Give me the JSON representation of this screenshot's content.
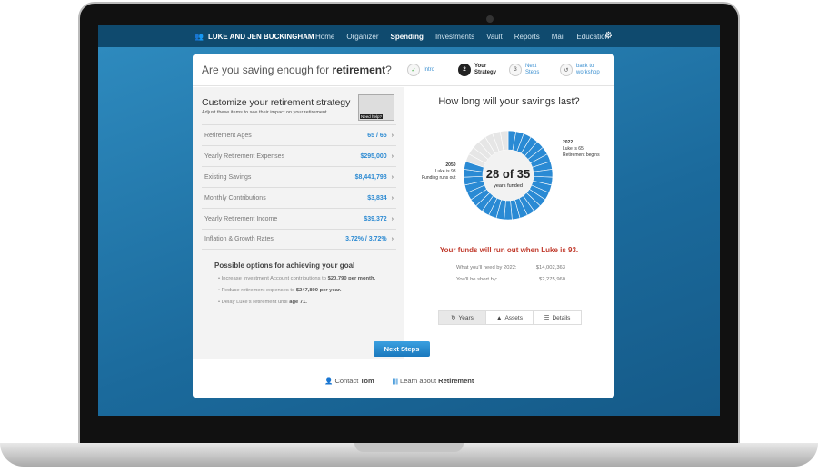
{
  "topbar": {
    "account": "LUKE AND JEN BUCKINGHAM",
    "nav": [
      "Home",
      "Organizer",
      "Spending",
      "Investments",
      "Vault",
      "Reports",
      "Mail",
      "Education"
    ],
    "active": "Spending"
  },
  "header": {
    "title_pre": "Are you saving enough for ",
    "title_bold": "retirement",
    "title_post": "?",
    "steps": [
      {
        "num": "✓",
        "label": "Intro"
      },
      {
        "num": "2",
        "label": "Your Strategy"
      },
      {
        "num": "3",
        "label": "Next Steps"
      },
      {
        "num": "↺",
        "label": "back to workshop"
      }
    ]
  },
  "left": {
    "title": "Customize your retirement strategy",
    "subtitle": "Adjust these items to see their impact on your retirement.",
    "video_label": "Need help?",
    "rows": [
      {
        "label": "Retirement Ages",
        "value": "65  / 65"
      },
      {
        "label": "Yearly Retirement Expenses",
        "value": "$295,000"
      },
      {
        "label": "Existing Savings",
        "value": "$8,441,798"
      },
      {
        "label": "Monthly Contributions",
        "value": "$3,834"
      },
      {
        "label": "Yearly Retirement Income",
        "value": "$39,372"
      },
      {
        "label": "Inflation & Growth Rates",
        "value": "3.72% / 3.72%"
      }
    ],
    "options_title": "Possible options for achieving your goal",
    "options": [
      {
        "pre": "Increase Investment Account contributions to ",
        "bold": "$20,790 per month."
      },
      {
        "pre": "Reduce retirement expenses to ",
        "bold": "$247,800 per year."
      },
      {
        "pre": "Delay Luke's retirement until ",
        "bold": "age 71."
      }
    ]
  },
  "right": {
    "title": "How long will your savings last?",
    "center_big": "28 of 35",
    "center_small": "years funded",
    "funded": 28,
    "total": 35,
    "ann_left": {
      "year": "2050",
      "l1": "Luke is 93",
      "l2": "Funding runs out"
    },
    "ann_right": {
      "year": "2022",
      "l1": "Luke is 65",
      "l2": "Retirement begins"
    },
    "alert": "Your funds will run out when Luke is 93.",
    "need_label": "What you'll need by 2022:",
    "need_value": "$14,002,363",
    "short_label": "You'll be short by:",
    "short_value": "$2,275,960",
    "tabs": [
      "Years",
      "Assets",
      "Details"
    ],
    "colors": {
      "funded": "#2a8ad4",
      "unfunded": "#e6e6e6"
    }
  },
  "footer": {
    "next": "Next Steps",
    "contact_pre": "Contact ",
    "contact_name": "Tom",
    "learn_pre": "Learn about ",
    "learn_topic": "Retirement"
  }
}
